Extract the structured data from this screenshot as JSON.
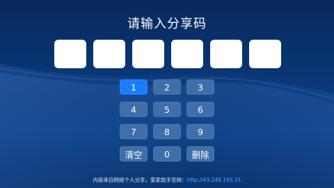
{
  "title": "请输入分享码",
  "code": [
    "",
    "",
    "",
    "",
    "",
    ""
  ],
  "keypad": {
    "keys": [
      "1",
      "2",
      "3",
      "4",
      "5",
      "6",
      "7",
      "8",
      "9",
      "清空",
      "0",
      "删除"
    ],
    "active_index": 0
  },
  "footer": {
    "text": "内容来自网络个人分享，爱家助手官网：",
    "url": "http://43.249.195.31"
  },
  "colors": {
    "background": "#0a3878",
    "key": "#3f6fa8",
    "key_active": "#1a7dfb",
    "link": "#58a7ff"
  }
}
